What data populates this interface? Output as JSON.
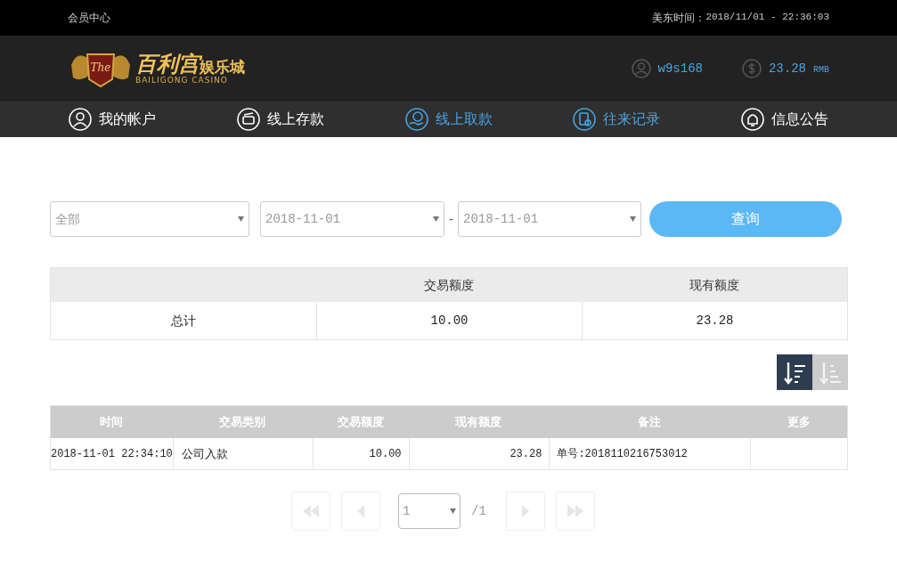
{
  "top_bar": {
    "title": "会员中心",
    "clock_label": "美东时间：",
    "clock": "2018/11/01 - 22:36:03"
  },
  "header": {
    "logo_title": "百利宫",
    "logo_suffix": "娱乐城",
    "logo_subtitle": "BAILIGONG CASINO",
    "emblem_text": "The",
    "username": "w9s168",
    "balance": "23.28",
    "currency": "RMB"
  },
  "nav": [
    {
      "label": "我的帐户",
      "kind": "user",
      "active": false
    },
    {
      "label": "线上存款",
      "kind": "deposit",
      "active": false
    },
    {
      "label": "线上取款",
      "kind": "withdraw",
      "active": true
    },
    {
      "label": "往来记录",
      "kind": "records",
      "active": true
    },
    {
      "label": "信息公告",
      "kind": "bell",
      "active": false
    }
  ],
  "filters": {
    "type": "全部",
    "date_from": "2018-11-01",
    "separator": "-",
    "date_to": "2018-11-01",
    "query_button": "查询"
  },
  "summary": {
    "columns": [
      "",
      "交易额度",
      "现有额度"
    ],
    "rows": [
      [
        "总计",
        "10.00",
        "23.28"
      ]
    ]
  },
  "sort_buttons": [
    {
      "kind": "desc",
      "selected": true
    },
    {
      "kind": "asc",
      "selected": false
    }
  ],
  "records": {
    "columns": [
      "时间",
      "交易类别",
      "交易额度",
      "现有额度",
      "备注",
      "更多"
    ],
    "rows": [
      [
        "2018-11-01 22:34:10",
        "公司入款",
        "10.00",
        "23.28",
        "单号:2018110216753012",
        ""
      ]
    ]
  },
  "pagination": {
    "page": "1",
    "total": "/1"
  }
}
